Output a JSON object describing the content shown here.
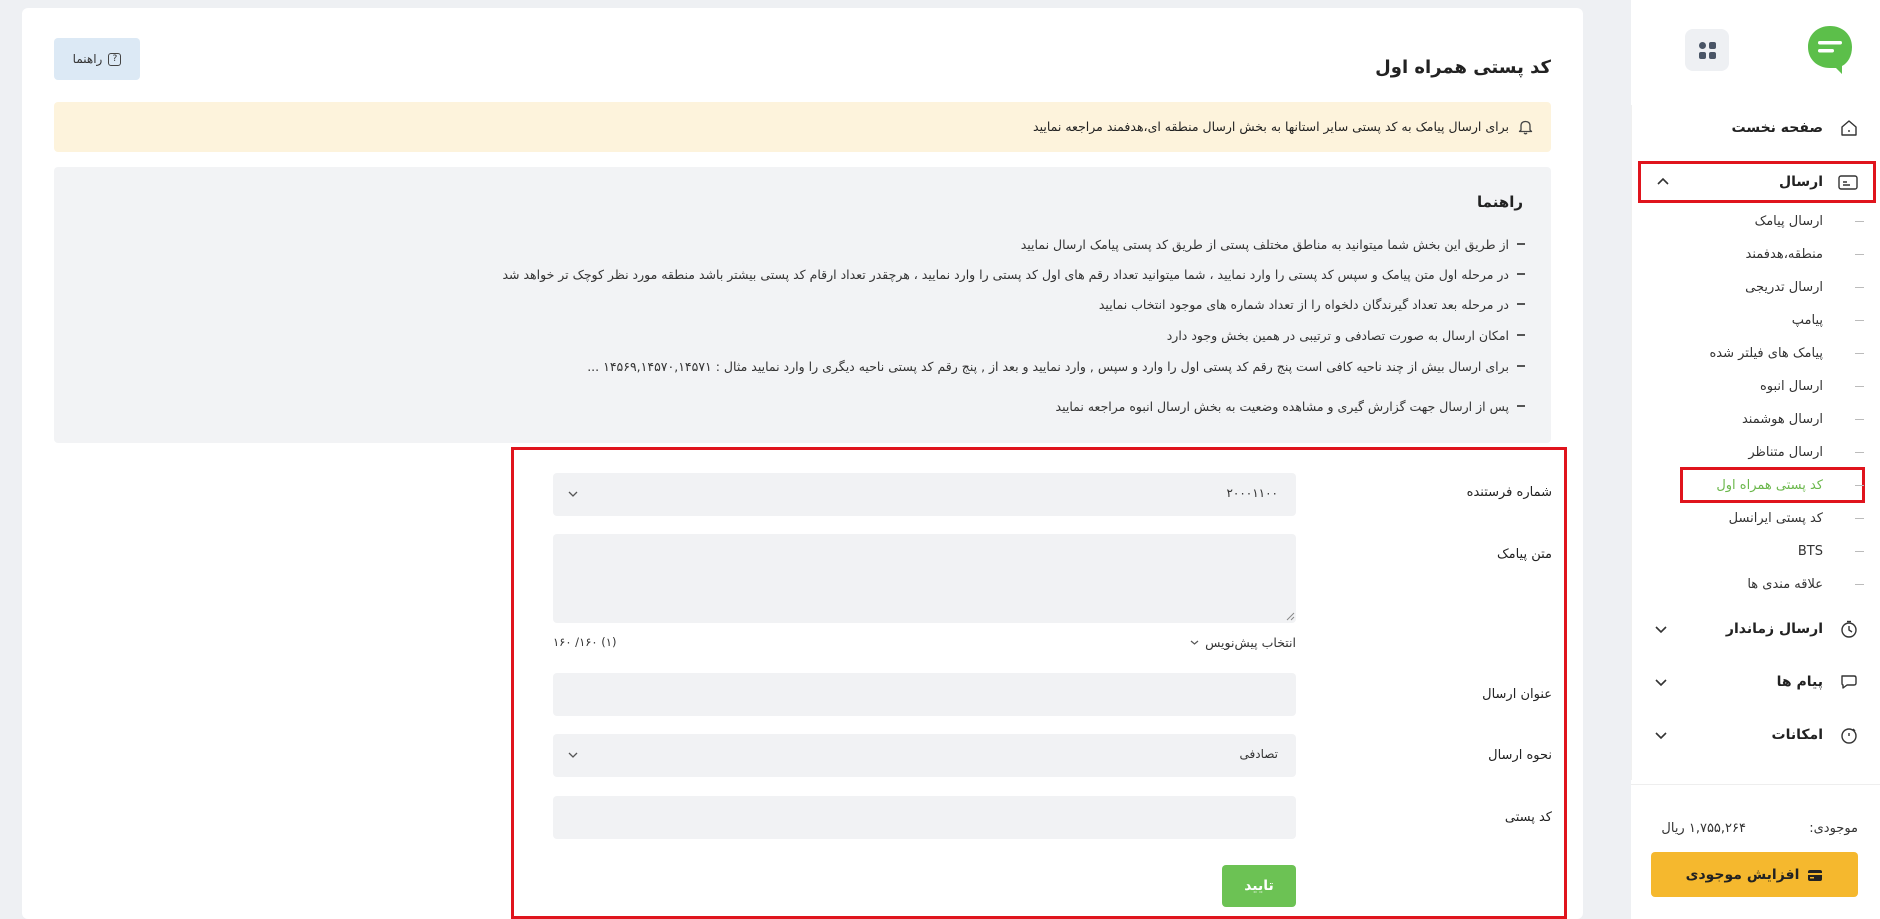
{
  "header": {
    "title": "کد پستی همراه اول",
    "guide_button": "راهنما"
  },
  "alert": {
    "text": "برای ارسال پیامک به کد پستی سایر استانها به بخش ارسال منطقه ای،هدفمند مراجعه نمایید"
  },
  "help": {
    "title": "راهنما",
    "items": [
      "از طریق این بخش شما میتوانید به مناطق مختلف پستی از طریق کد پستی پیامک ارسال نمایید",
      "در مرحله اول متن پیامک و سپس کد پستی را وارد نمایید ، شما میتوانید تعداد رقم های اول کد پستی را وارد نمایید ، هرچقدر تعداد ارقام کد پستی بیشتر باشد منطقه مورد نظر کوچک تر خواهد شد",
      "در مرحله بعد تعداد گیرندگان دلخواه را از تعداد شماره های موجود انتخاب نمایید",
      "امکان ارسال به صورت تصادفی و ترتیبی در همین بخش وجود دارد",
      "برای ارسال بیش از چند ناحیه کافی است پنج رقم کد پستی اول را وارد و سپس , وارد نمایید و بعد از , پنج رقم کد پستی ناحیه دیگری را وارد نمایید مثال : ۱۴۵۶۹,۱۴۵۷۰,۱۴۵۷۱ ...",
      "پس از ارسال جهت گزارش گیری و مشاهده وضعیت به بخش ارسال انبوه مراجعه نمایید"
    ]
  },
  "form": {
    "sender_label": "شماره فرستنده",
    "sender_value": "۲۰۰۰۱۱۰۰",
    "message_label": "متن پیامک",
    "message_value": "",
    "template_label": "انتخاب پیش‌نویس",
    "counter": "(۱) ۱۶۰/ ۱۶۰",
    "title_label": "عنوان ارسال",
    "title_value": "",
    "method_label": "نحوه ارسال",
    "method_value": "تصادفی",
    "postal_label": "کد پستی",
    "postal_value": "",
    "submit": "تایید"
  },
  "sidebar": {
    "home": "صفحه نخست",
    "send": "ارسال",
    "send_items": [
      "ارسال پیامک",
      "منطقه،هدفمند",
      "ارسال تدریجی",
      "پیامپ",
      "پیامک های فیلتر شده",
      "ارسال انبوه",
      "ارسال هوشمند",
      "ارسال متناظر",
      "کد پستی همراه اول",
      "کد پستی ایرانسل",
      "BTS",
      "علاقه مندی ها"
    ],
    "scheduled": "ارسال زماندار",
    "messages": "پیام ها",
    "features": "امکانات",
    "balance_label": "موجودی:",
    "balance_value": "۱,۷۵۵,۲۶۴ ریال",
    "topup": "افزایش موجودی"
  },
  "colors": {
    "accent_green": "#6cc254",
    "active_text": "#6cb84d",
    "topup_yellow": "#f5b82e",
    "alert_bg": "#fdf3dc",
    "highlight_red": "#e0141d"
  }
}
